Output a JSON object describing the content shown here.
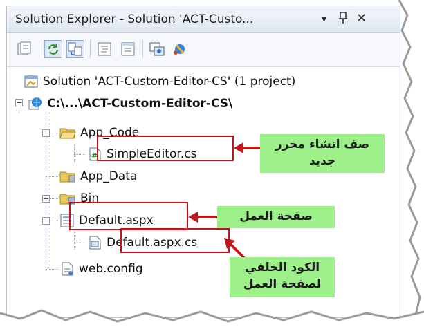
{
  "window": {
    "title": "Solution Explorer - Solution 'ACT-Custo...",
    "dropdown_glyph": "▾",
    "pin_glyph": "ꟷ",
    "close_glyph": "✕"
  },
  "toolbar": {
    "buttons": [
      {
        "icon": "properties-icon"
      },
      {
        "icon": "refresh-icon",
        "active": true
      },
      {
        "icon": "nest-related-files-icon",
        "active": true
      },
      {
        "icon": "view-code-icon"
      },
      {
        "icon": "view-designer-icon"
      },
      {
        "icon": "copy-website-icon"
      },
      {
        "icon": "asp-net-configuration-icon"
      }
    ]
  },
  "tree": {
    "solution": "Solution 'ACT-Custom-Editor-CS' (1 project)",
    "project": "C:\\...\\ACT-Custom-Editor-CS\\",
    "app_code": "App_Code",
    "simple_editor": "SimpleEditor.cs",
    "app_data": "App_Data",
    "bin": "Bin",
    "default_aspx": "Default.aspx",
    "default_aspx_cs": "Default.aspx.cs",
    "web_config": "web.config"
  },
  "callouts": {
    "new_editor_line1": "صف انشاء محرر",
    "new_editor_line2": "جديد",
    "work_page": "صفحة العمل",
    "code_behind_line1": "الكود الخلفي",
    "code_behind_line2": "لصفحة العمل"
  },
  "colors": {
    "highlight": "#c0171d",
    "callout_bg": "#9ef08a",
    "folder": "#e8c75a"
  }
}
